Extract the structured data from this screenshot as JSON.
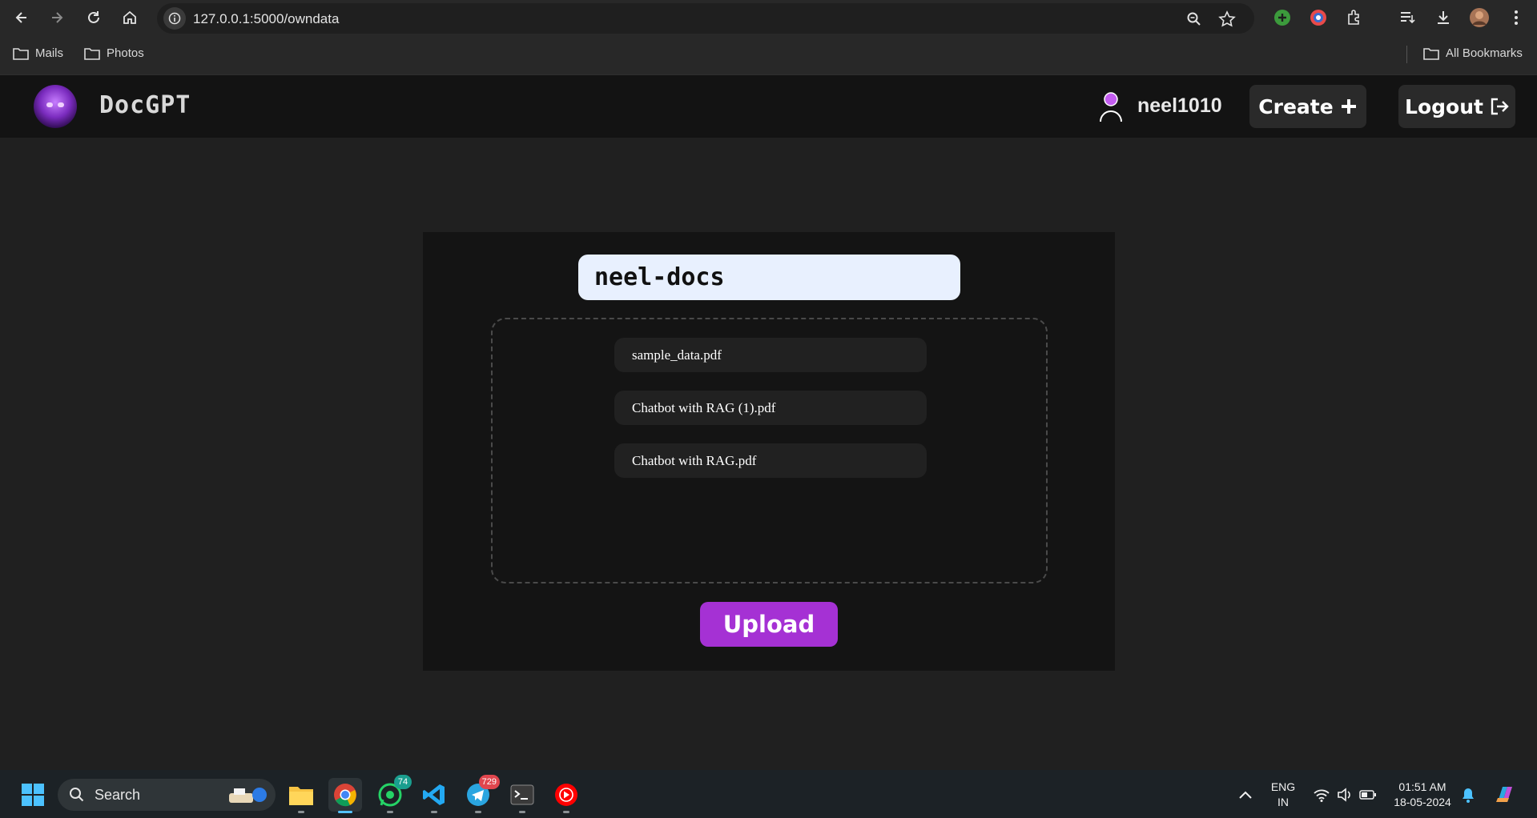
{
  "browser": {
    "url": "127.0.0.1:5000/owndata",
    "bookmarks": [
      {
        "label": "Mails"
      },
      {
        "label": "Photos"
      }
    ],
    "all_bookmarks_label": "All Bookmarks"
  },
  "header": {
    "brand": "DocGPT",
    "username": "neel1010",
    "create_label": "Create",
    "logout_label": "Logout"
  },
  "main": {
    "collection_name": "neel-docs",
    "files": [
      {
        "name": "sample_data.pdf"
      },
      {
        "name": "Chatbot with RAG (1).pdf"
      },
      {
        "name": "Chatbot with RAG.pdf"
      }
    ],
    "upload_label": "Upload"
  },
  "taskbar": {
    "search_label": "Search",
    "whatsapp_badge": "74",
    "telegram_badge": "729",
    "language": "ENG",
    "region": "IN",
    "time": "01:51 AM",
    "date": "18-05-2024"
  },
  "colors": {
    "accent": "#a531d4",
    "header_bg": "#131313",
    "page_bg": "#202020",
    "card_bg": "#141414",
    "input_bg": "#e8f0fe"
  }
}
